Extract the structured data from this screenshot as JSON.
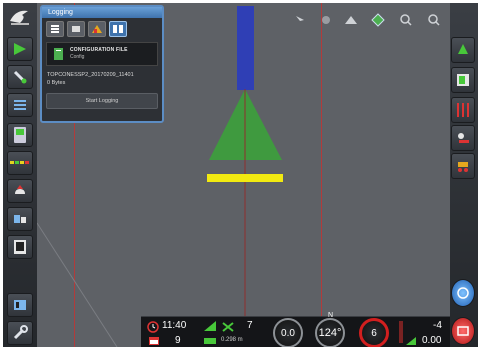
{
  "panel": {
    "header": "Logging",
    "config_title": "CONFIGURATION FILE",
    "config_value": "Config",
    "file_name": "TOPCONESSP2_20170209_11401",
    "file_size": "0 Bytes",
    "start_button": "Start Logging"
  },
  "status": {
    "time": "11:40",
    "sat_count": "7",
    "date_day": "9",
    "accuracy": "0.298 m",
    "speed": "0.0",
    "heading": "124°",
    "compass_n": "N",
    "rate": "6",
    "offset_top": "-4",
    "offset_bottom": "0.00"
  },
  "colors": {
    "guidance_blue": "#2f3fb5",
    "vehicle_green": "#3f9a3f",
    "implement_yellow": "#f2ea10",
    "guide_line_red": "#b23b3b",
    "panel_accent": "#5c8dc4",
    "highlight_ring": "#d21f1f"
  },
  "icons": {
    "top_right_button": "blue-steering-icon",
    "bottom_right_button": "red-engage-icon"
  }
}
